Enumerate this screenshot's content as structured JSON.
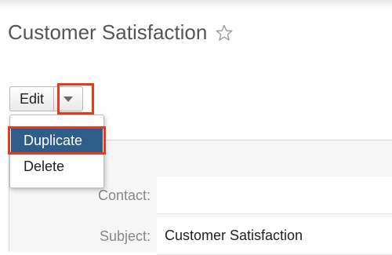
{
  "header": {
    "title": "Customer Satisfaction"
  },
  "actions": {
    "edit_label": "Edit",
    "menu": {
      "duplicate": "Duplicate",
      "delete": "Delete"
    }
  },
  "record": {
    "fields": {
      "contact_label": "Contact:",
      "contact_value": "",
      "subject_label": "Subject:",
      "subject_value": "Customer Satisfaction"
    }
  },
  "colors": {
    "highlight": "#e43b1f",
    "menu_selected": "#2f5d8a"
  }
}
